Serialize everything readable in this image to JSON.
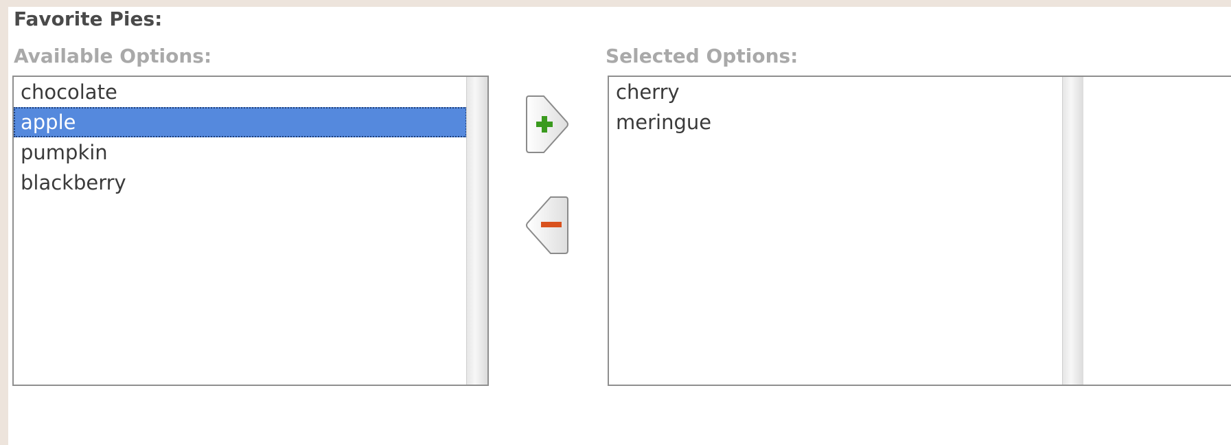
{
  "field": {
    "label": "Favorite Pies:"
  },
  "available": {
    "label": "Available Options:",
    "items": [
      "chocolate",
      "apple",
      "pumpkin",
      "blackberry"
    ],
    "selected_index": 1
  },
  "selected": {
    "label": "Selected Options:",
    "items": [
      "cherry",
      "meringue"
    ]
  },
  "buttons": {
    "add_icon": "plus-icon",
    "remove_icon": "minus-icon"
  },
  "colors": {
    "selection": "#5589dd",
    "plus": "#3a9a1e",
    "minus": "#d9521e"
  }
}
